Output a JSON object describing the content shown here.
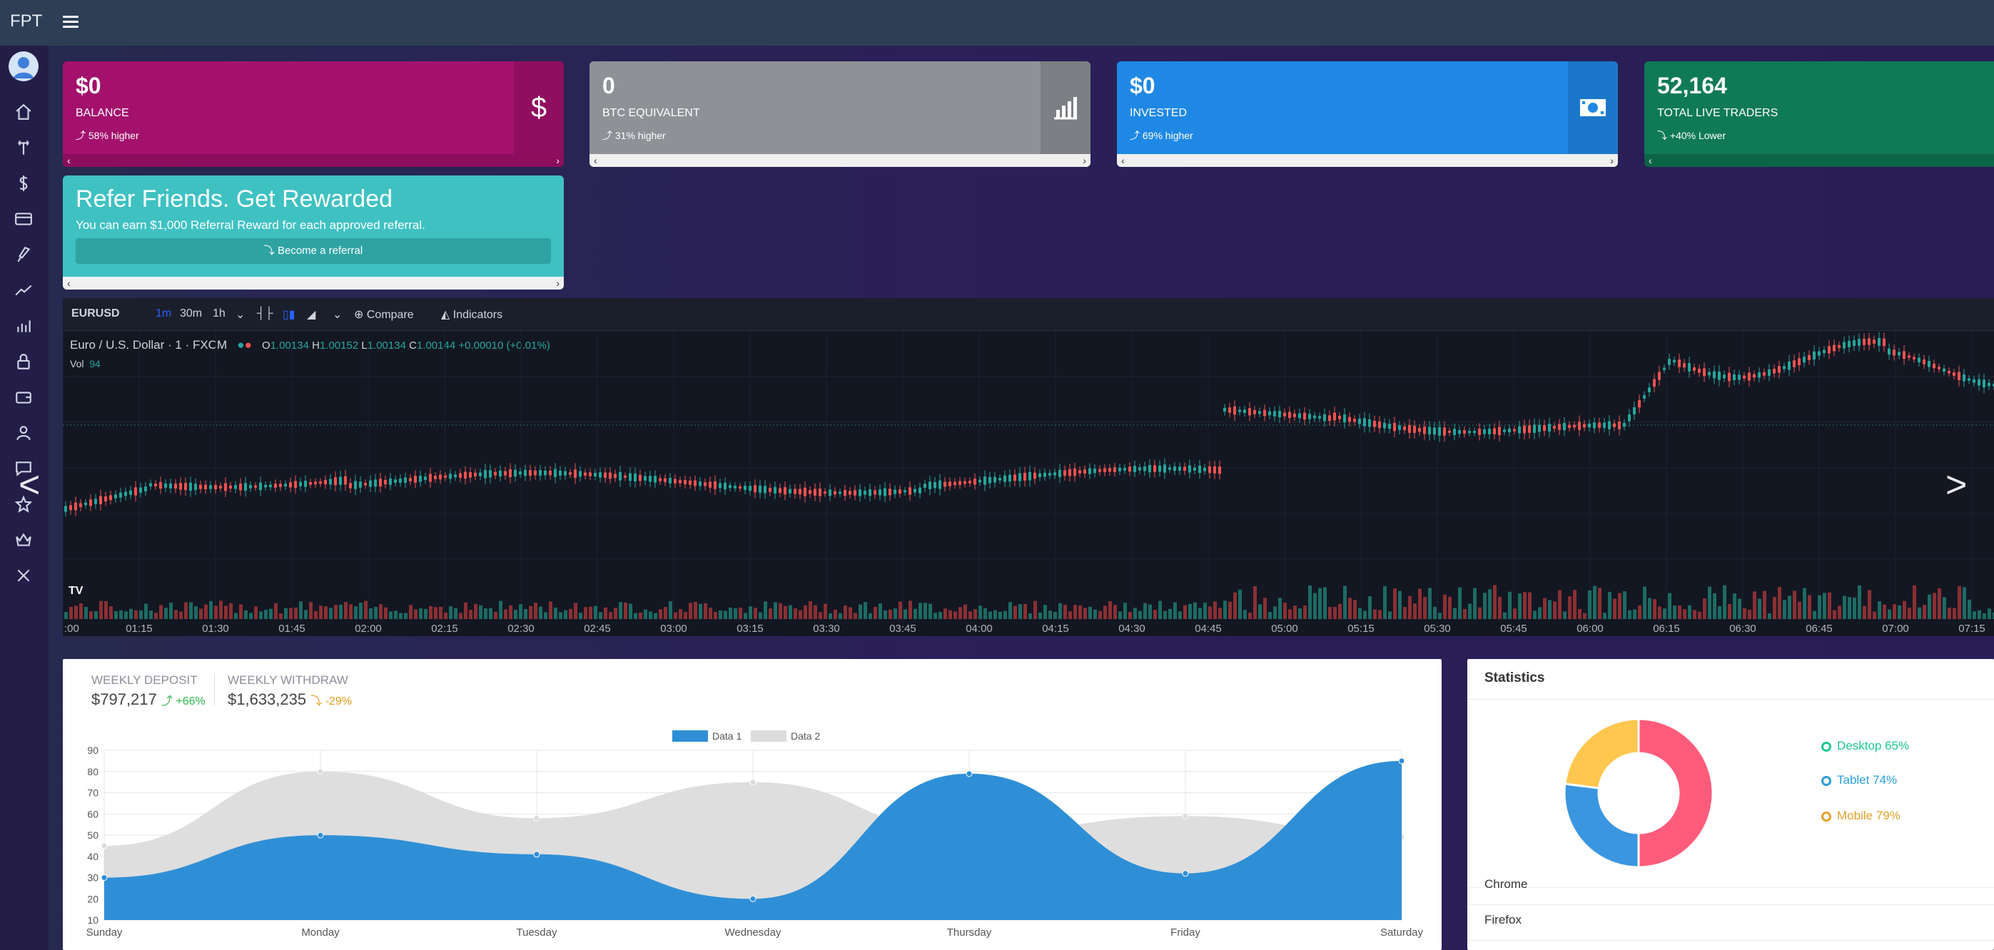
{
  "app": {
    "brand": "FPT"
  },
  "colors": {
    "balance": "#a3116d",
    "btc": "#8e9196",
    "invested": "#1f88e5",
    "traders": "#0f7a55",
    "refer": "#3fc1c2"
  },
  "sidebar": {
    "icons": [
      "home-icon",
      "antenna-icon",
      "dollar-icon",
      "credit-card-icon",
      "rocket-icon",
      "trend-line-icon",
      "bar-chart-icon",
      "lock-icon",
      "wallet-icon",
      "user-icon",
      "chat-icon",
      "star-icon",
      "crown-icon",
      "close-icon"
    ]
  },
  "cards": {
    "balance": {
      "value": "$0",
      "label": "BALANCE",
      "change": "58% higher",
      "icon": "$"
    },
    "btc": {
      "value": "0",
      "label": "BTC EQUIVALENT",
      "change": "31% higher"
    },
    "invested": {
      "value": "$0",
      "label": "INVESTED",
      "change": "69% higher"
    },
    "traders": {
      "value": "52,164",
      "label": "TOTAL LIVE TRADERS",
      "change": "+40% Lower"
    }
  },
  "refer": {
    "title": "Refer Friends. Get Rewarded",
    "subtitle": "You can earn $1,000 Referral Reward for each approved referral.",
    "button": "Become a referral"
  },
  "tv": {
    "symbol": "EURUSD",
    "intervals": [
      "1m",
      "30m",
      "1h"
    ],
    "compare": "Compare",
    "indicators": "Indicators",
    "title": "Euro / U.S. Dollar",
    "interval": "1",
    "source": "FXCM",
    "ohlc": {
      "O": "1.00134",
      "H": "1.00152",
      "L": "1.00134",
      "C": "1.00144",
      "chg": "+0.00010 (+0.01%)"
    },
    "vol_label": "Vol",
    "vol_value": "94",
    "time_labels": [
      ":00",
      "01:15",
      "01:30",
      "01:45",
      "02:00",
      "02:15",
      "02:30",
      "02:45",
      "03:00",
      "03:15",
      "03:30",
      "03:45",
      "04:00",
      "04:15",
      "04:30",
      "04:45",
      "05:00",
      "05:15",
      "05:30",
      "05:45",
      "06:00",
      "06:15",
      "06:30",
      "06:45",
      "07:00",
      "07:15"
    ]
  },
  "weekly": {
    "deposit_label": "WEEKLY DEPOSIT",
    "deposit_value": "$797,217",
    "deposit_change": "+66%",
    "withdraw_label": "WEEKLY WITHDRAW",
    "withdraw_value": "$1,633,235",
    "withdraw_change": "-29%"
  },
  "chart_data": {
    "type": "area",
    "categories": [
      "Sunday",
      "Monday",
      "Tuesday",
      "Wednesday",
      "Thursday",
      "Friday",
      "Saturday"
    ],
    "series": [
      {
        "name": "Data 1",
        "values": [
          30,
          50,
          41,
          20,
          79,
          32,
          85
        ],
        "color": "#2f8fd6"
      },
      {
        "name": "Data 2",
        "values": [
          45,
          80,
          58,
          75,
          51,
          59,
          49
        ],
        "color": "#dcdcdc"
      }
    ],
    "yticks": [
      10,
      20,
      30,
      40,
      50,
      60,
      70,
      80,
      90
    ],
    "ylim": [
      10,
      90
    ],
    "grid": true,
    "legend": "top"
  },
  "stats": {
    "title": "Statistics",
    "chart_data": {
      "type": "pie",
      "labels": [
        "Desktop",
        "Tablet",
        "Mobile"
      ],
      "colors": [
        "#ff5c7c",
        "#3a96e0",
        "#ffc74d"
      ],
      "values": [
        50,
        27,
        23
      ]
    },
    "legend": [
      {
        "label": "Desktop 65%",
        "color": "#1ec790"
      },
      {
        "label": "Tablet 74%",
        "color": "#2b9ed9"
      },
      {
        "label": "Mobile 79%",
        "color": "#e0a22a"
      }
    ],
    "browsers": [
      "Chrome",
      "Firefox"
    ]
  }
}
